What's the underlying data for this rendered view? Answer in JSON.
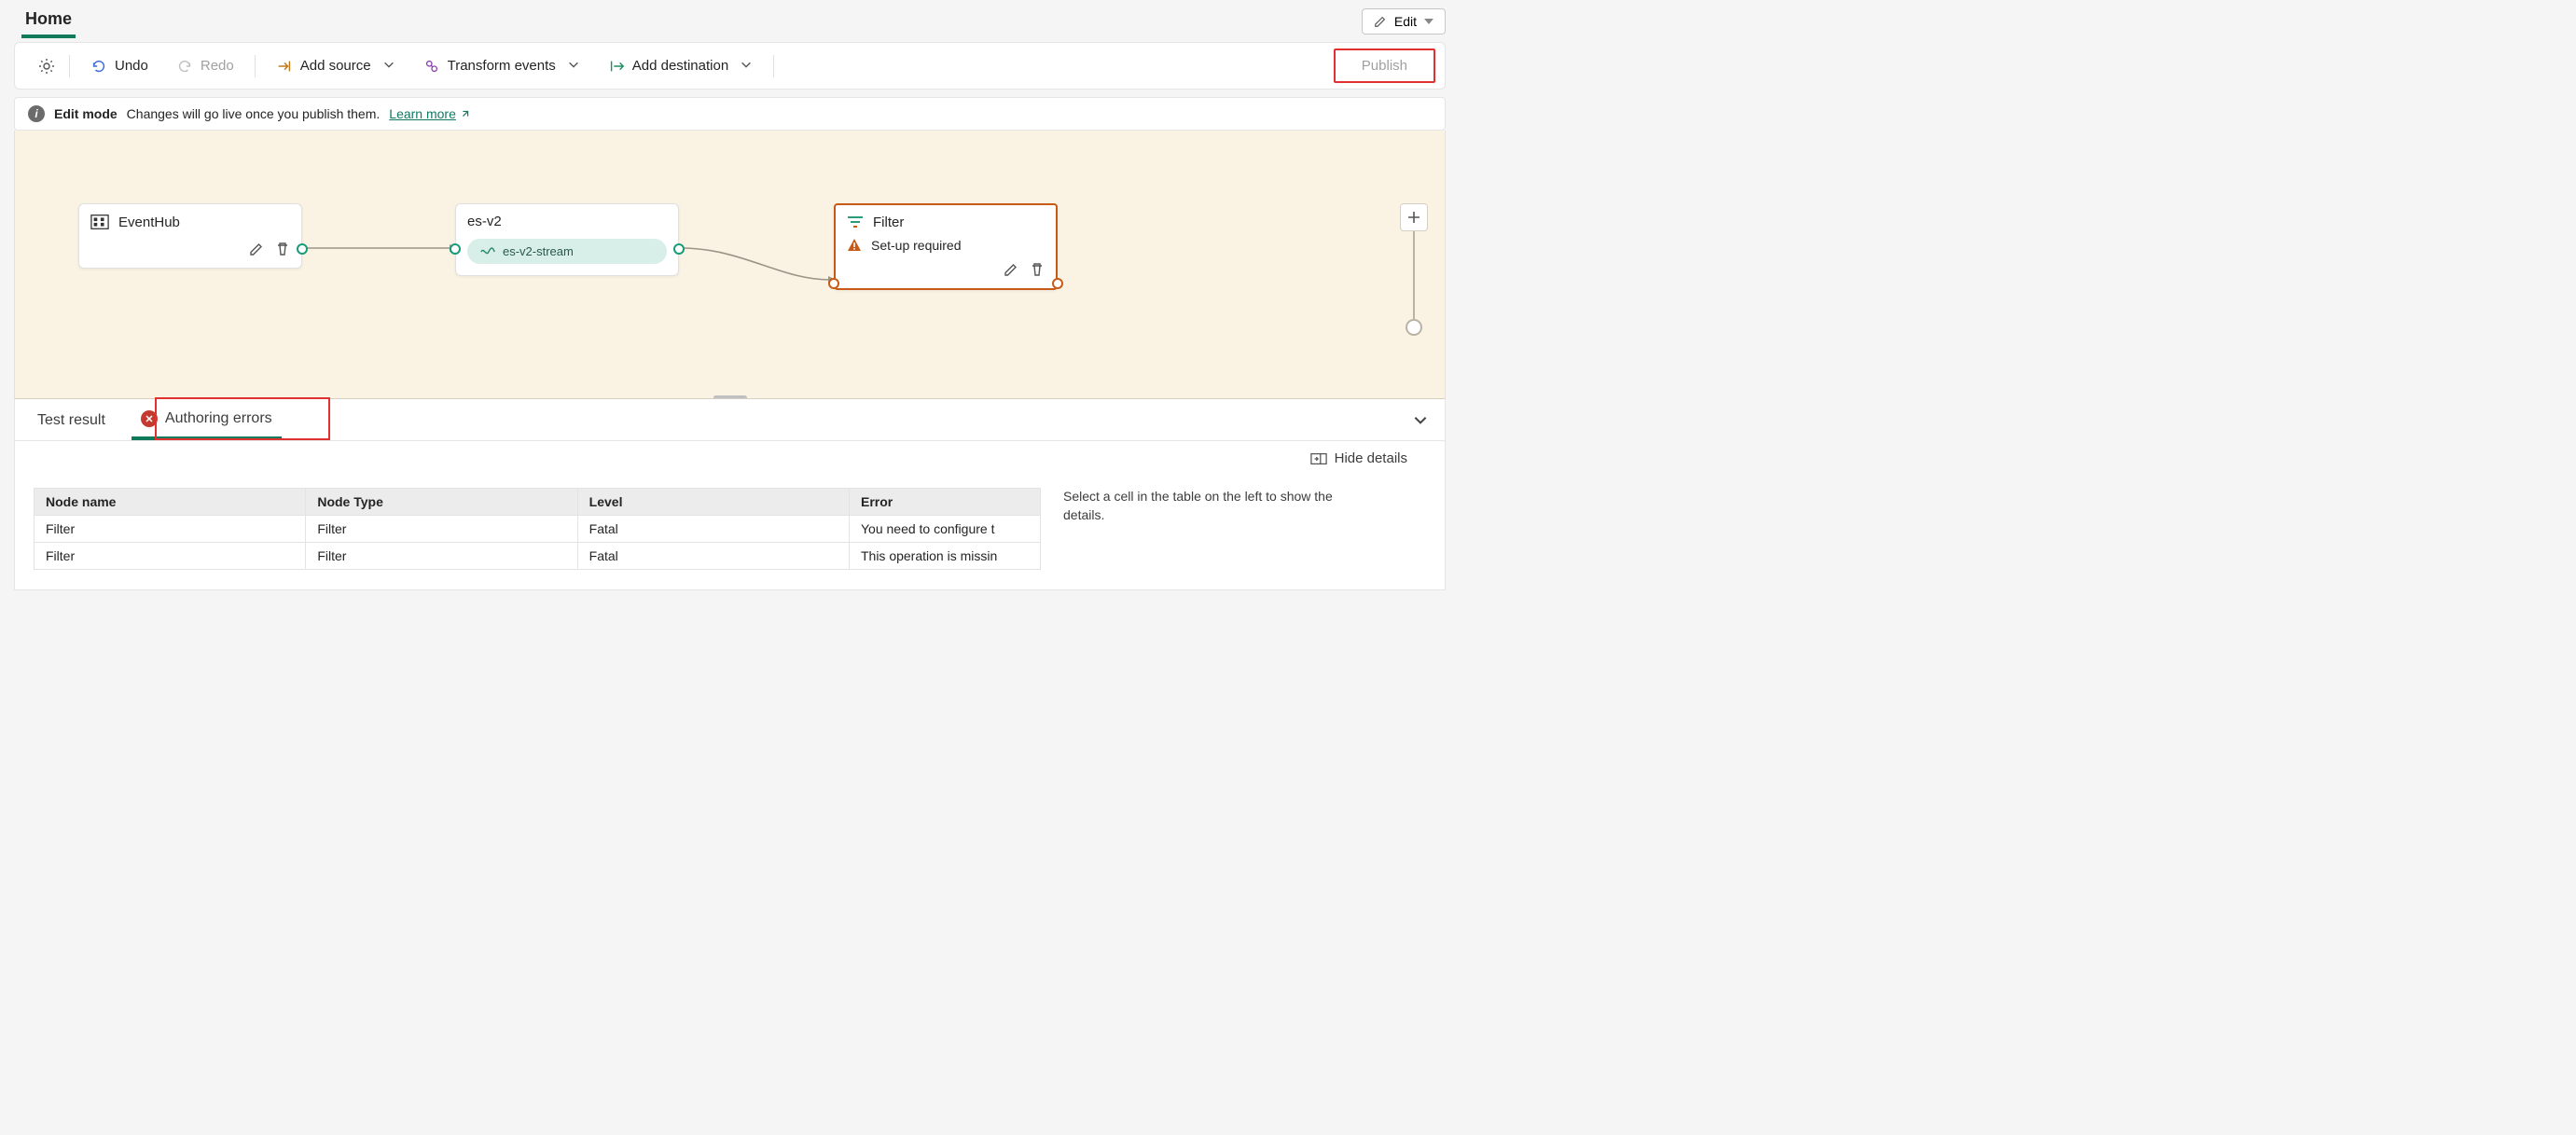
{
  "header": {
    "home_tab": "Home",
    "edit_label": "Edit"
  },
  "toolbar": {
    "undo": "Undo",
    "redo": "Redo",
    "add_source": "Add source",
    "transform": "Transform events",
    "add_destination": "Add destination",
    "publish": "Publish"
  },
  "info": {
    "mode": "Edit mode",
    "message": "Changes will go live once you publish them.",
    "learn_more": "Learn more"
  },
  "nodes": {
    "eventhub": {
      "title": "EventHub"
    },
    "esv2": {
      "title": "es-v2",
      "stream": "es-v2-stream"
    },
    "filter": {
      "title": "Filter",
      "status": "Set-up required"
    }
  },
  "tabs": {
    "test_result": "Test result",
    "authoring_errors": "Authoring errors"
  },
  "details": {
    "hide": "Hide details",
    "side_help": "Select a cell in the table on the left to show the details.",
    "columns": [
      "Node name",
      "Node Type",
      "Level",
      "Error"
    ],
    "rows": [
      {
        "node_name": "Filter",
        "node_type": "Filter",
        "level": "Fatal",
        "error": "You need to configure t"
      },
      {
        "node_name": "Filter",
        "node_type": "Filter",
        "level": "Fatal",
        "error": "This operation is missin"
      }
    ]
  }
}
